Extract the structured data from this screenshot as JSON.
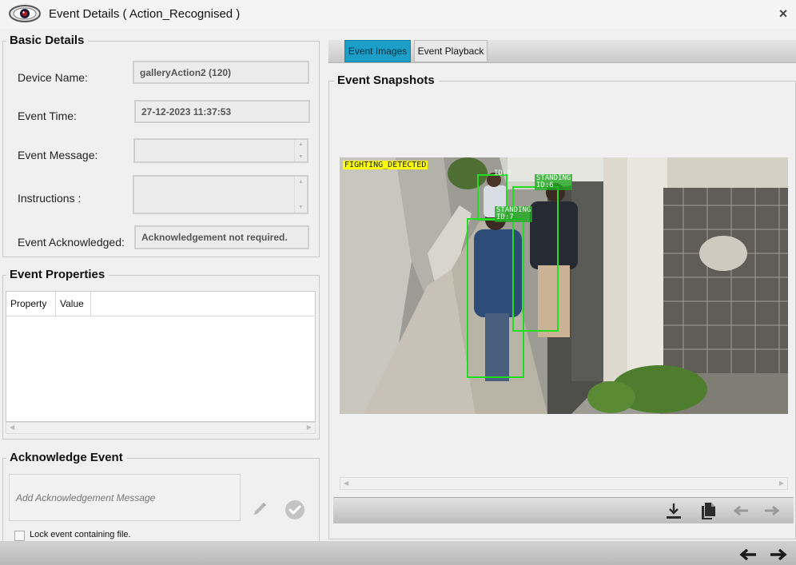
{
  "window": {
    "title": "Event Details ( Action_Recognised )",
    "close_glyph": "×",
    "logo_icon": "eye-icon"
  },
  "basic_details": {
    "title": "Basic Details",
    "device_name_label": "Device Name:",
    "device_name_value": "galleryAction2 (120)",
    "event_time_label": "Event Time:",
    "event_time_value": "27-12-2023 11:37:53",
    "event_message_label": "Event Message:",
    "event_message_value": "",
    "instructions_label": "Instructions :",
    "instructions_value": "",
    "event_ack_label": "Event Acknowledged:",
    "event_ack_value": "Acknowledgement not required."
  },
  "event_properties": {
    "title": "Event Properties",
    "columns": [
      "Property",
      "Value"
    ],
    "rows": []
  },
  "acknowledge_event": {
    "title": "Acknowledge Event",
    "placeholder": "Add Acknowledgement Message",
    "lock_label": "Lock event containing file.",
    "lock_checked": false
  },
  "tabs": {
    "items": [
      {
        "label": "Event Images",
        "active": true
      },
      {
        "label": "Event Playback",
        "active": false
      }
    ]
  },
  "snapshots": {
    "title": "Event Snapshots",
    "overlay_label": "FIGHTING_DETECTED",
    "detections": [
      {
        "label": "ID:9"
      },
      {
        "label": "STANDING",
        "id": "ID:6"
      },
      {
        "label": "STANDING",
        "id": "ID:7"
      }
    ]
  },
  "toolbar": {
    "icons": [
      "download-icon",
      "copy-icon",
      "previous-icon",
      "next-icon"
    ]
  },
  "bottom": {
    "icons": [
      "previous-event-icon",
      "next-event-icon"
    ]
  },
  "colors": {
    "tab_active": "#1c9ec7",
    "detection_box": "#22dd22",
    "overlay_label_bg": "#ffff00"
  }
}
